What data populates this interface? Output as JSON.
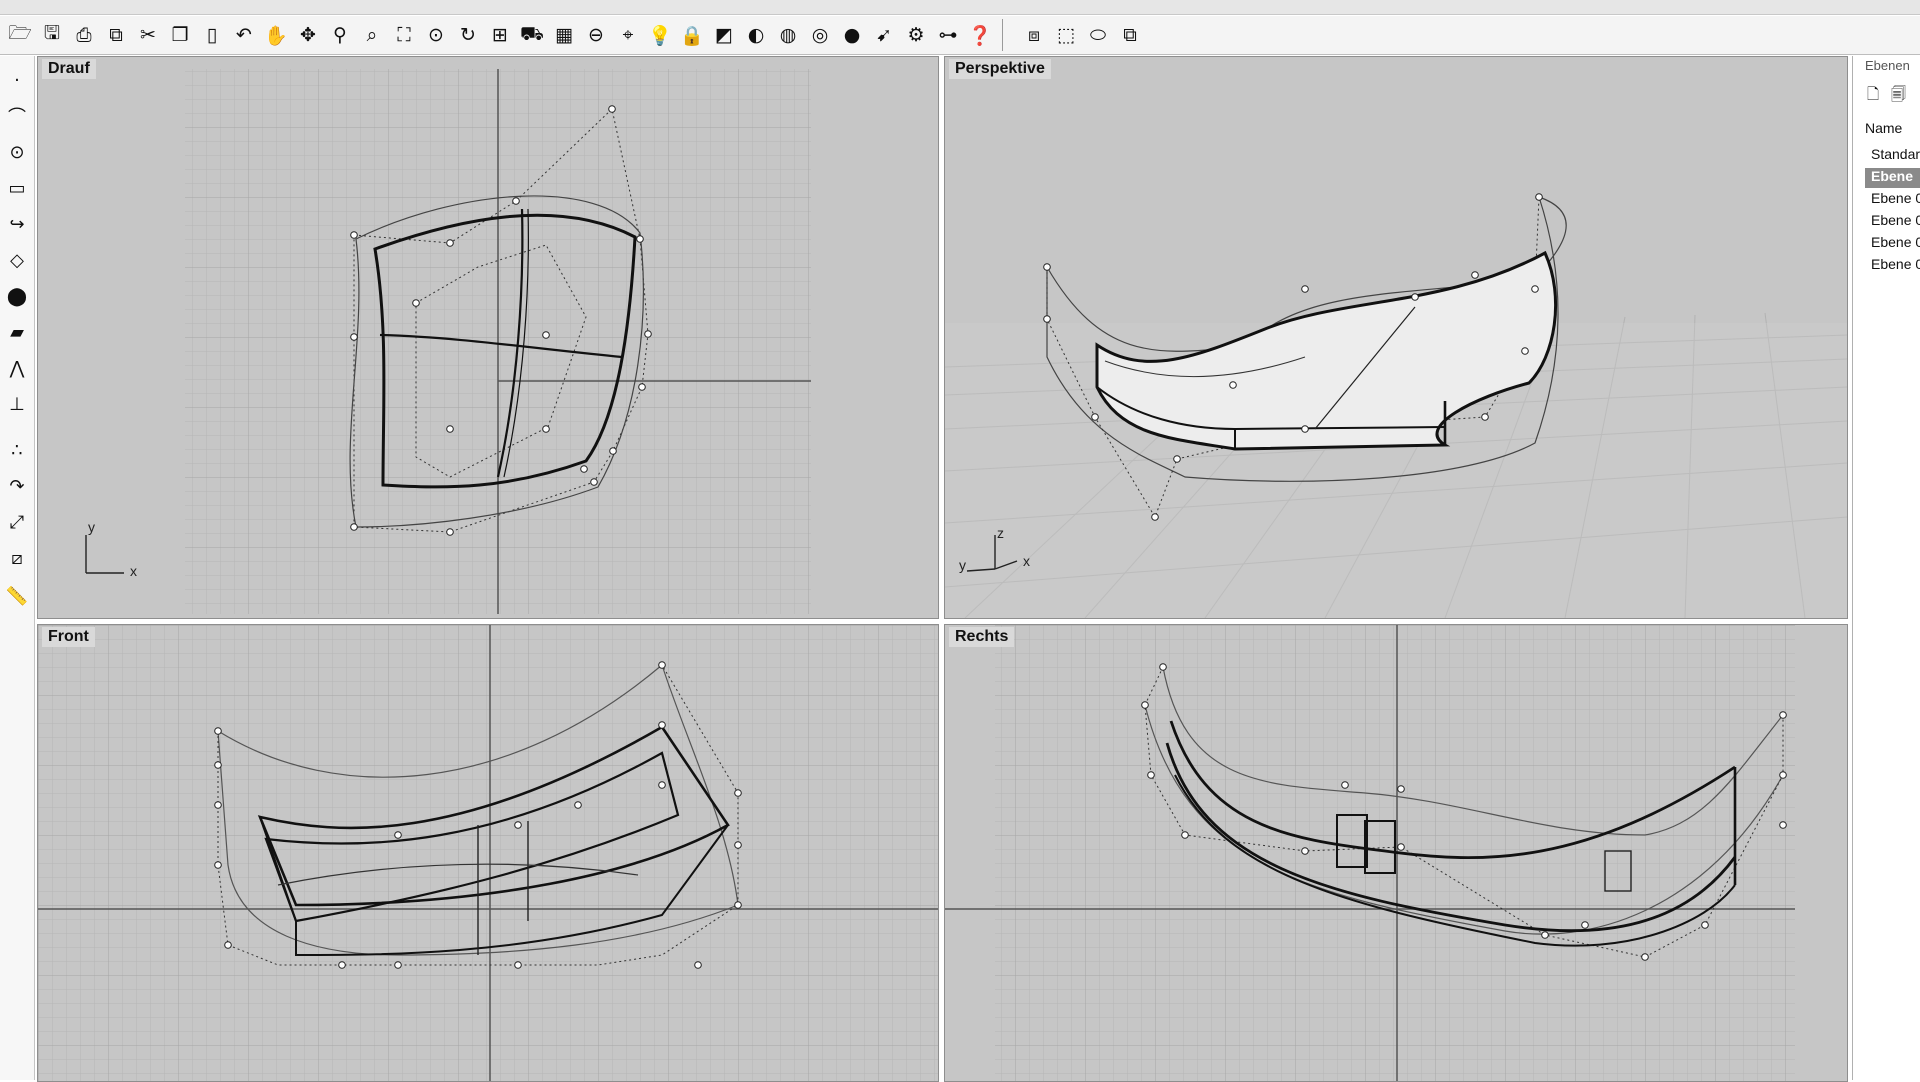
{
  "toolbar": {
    "icons": [
      "open-icon",
      "save-icon",
      "print-icon",
      "import-icon",
      "cut-icon",
      "copy-icon",
      "paste-icon",
      "undo-icon",
      "pan-hand-icon",
      "rotate-view-icon",
      "zoom-icon",
      "zoom-window-icon",
      "zoom-extents-icon",
      "zoom-selected-icon",
      "redo-view-icon",
      "four-viewports-icon",
      "car-icon",
      "plane-grid-icon",
      "cplane-icon",
      "snap-icon",
      "light-bulb-icon",
      "lock-icon",
      "shade-icon",
      "render-sphere-icon",
      "wireframe-sphere-icon",
      "ghost-sphere-icon",
      "black-sphere-icon",
      "arrow-icon",
      "gear-icon",
      "options-icon",
      "help-icon",
      "cage-edit-icon",
      "box-edit-icon",
      "flow-icon",
      "control-box-icon"
    ]
  },
  "left_toolbar": {
    "icons": [
      "point-icon",
      "curve-icon",
      "circle-icon",
      "rectangle-icon",
      "fillet-icon",
      "surface-icon",
      "solid-icon",
      "mesh-icon",
      "dimension-icon",
      "transform-icon",
      "boolean-icon",
      "sweep-icon",
      "scale-icon",
      "analyze-icon",
      "ruler-icon"
    ]
  },
  "viewports": {
    "top": {
      "label": "Drauf",
      "axis_x": "x",
      "axis_y": "y"
    },
    "persp": {
      "label": "Perspektive",
      "axis_x": "x",
      "axis_y": "y",
      "axis_z": "z"
    },
    "front": {
      "label": "Front"
    },
    "right": {
      "label": "Rechts"
    }
  },
  "layers": {
    "title": "Ebenen",
    "column_header": "Name",
    "rows": [
      "Standard",
      "Ebene",
      "Ebene 0",
      "Ebene 0",
      "Ebene 0",
      "Ebene 0"
    ],
    "selected_index": 1
  },
  "colors": {
    "viewport_bg": "#c6c6c6",
    "grid": "#b4b4b4",
    "curve": "#111111"
  }
}
